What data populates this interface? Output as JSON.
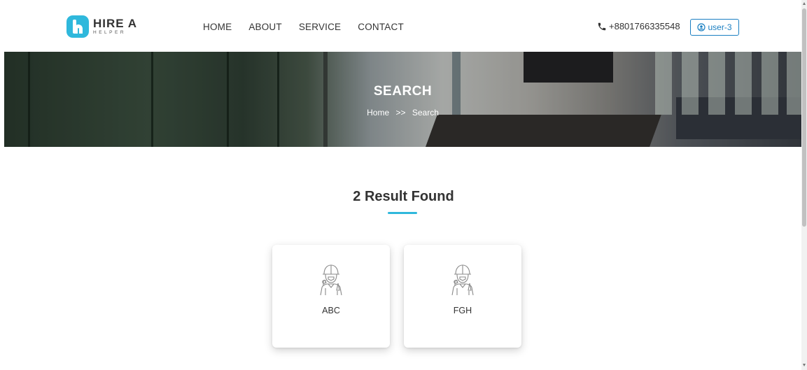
{
  "header": {
    "logo": {
      "title": "HIRE A",
      "subtitle": "HELPER"
    },
    "nav": [
      {
        "label": "HOME"
      },
      {
        "label": "ABOUT"
      },
      {
        "label": "SERVICE"
      },
      {
        "label": "CONTACT"
      }
    ],
    "phone": "+8801766335548",
    "user_button": "user-3"
  },
  "banner": {
    "title": "SEARCH",
    "breadcrumb": {
      "home": "Home",
      "separator": ">>",
      "current": "Search"
    }
  },
  "results": {
    "title": "2 Result Found",
    "items": [
      {
        "label": "ABC",
        "icon": "worker-icon"
      },
      {
        "label": "FGH",
        "icon": "worker-icon"
      }
    ]
  },
  "colors": {
    "accent": "#2fb8dc",
    "user_button": "#1a7fc2"
  }
}
